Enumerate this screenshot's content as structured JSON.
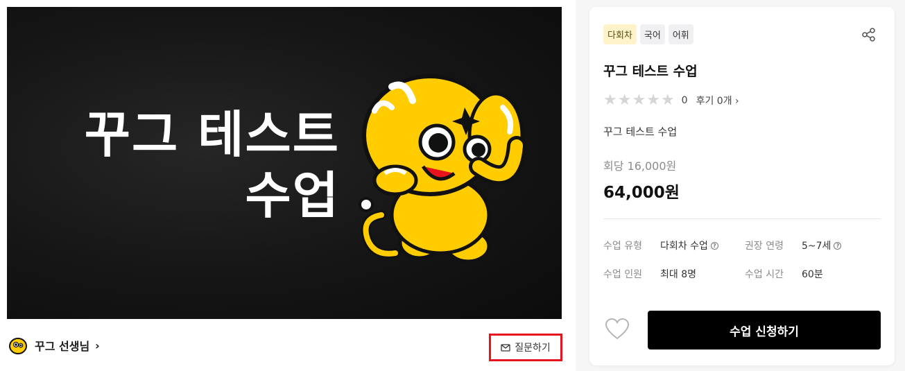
{
  "hero": {
    "title_line1": "꾸그 테스트",
    "title_line2": "수업"
  },
  "teacher": {
    "name": "꾸그 선생님",
    "chevron": "›"
  },
  "ask_button": {
    "label": "질문하기",
    "icon": "mail-icon"
  },
  "card": {
    "tags": [
      "다회차",
      "국어",
      "어휘"
    ],
    "title": "꾸그 테스트 수업",
    "rating": {
      "stars": 0,
      "score": "0",
      "review_text": "후기 0개 ›"
    },
    "subtitle": "꾸그 테스트 수업",
    "per_session": "회당 16,000원",
    "price": "64,000원",
    "info": {
      "type_key": "수업 유형",
      "type_val": "다회차 수업",
      "age_key": "권장 연령",
      "age_val": "5~7세",
      "size_key": "수업 인원",
      "size_val": "최대 8명",
      "time_key": "수업 시간",
      "time_val": "60분"
    },
    "apply_label": "수업 신청하기"
  },
  "colors": {
    "accent_red": "#e8141d",
    "mascot_yellow": "#ffcc00",
    "tag_highlight": "#fff3c9"
  }
}
